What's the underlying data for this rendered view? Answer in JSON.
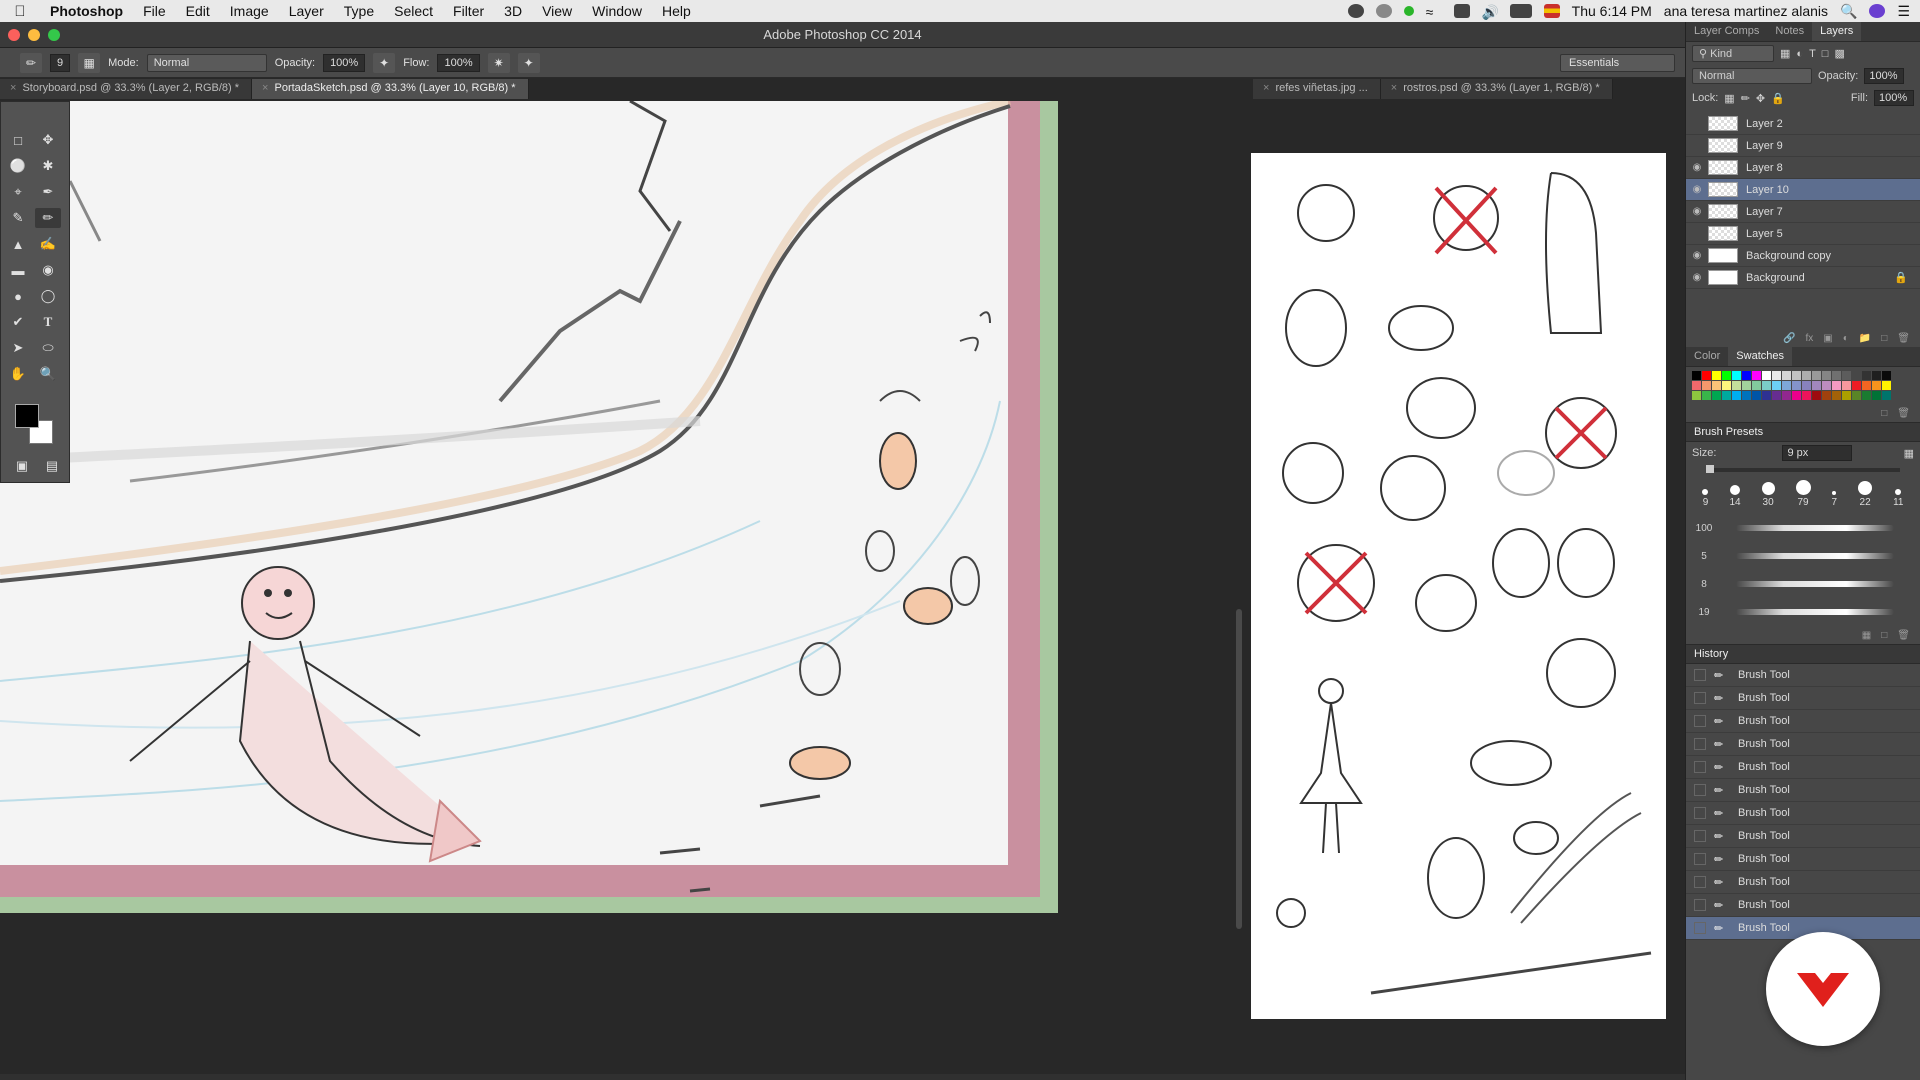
{
  "menubar": {
    "items": [
      "Photoshop",
      "File",
      "Edit",
      "Image",
      "Layer",
      "Type",
      "Select",
      "Filter",
      "3D",
      "View",
      "Window",
      "Help"
    ],
    "clock": "Thu 6:14 PM",
    "user": "ana teresa martinez alanis"
  },
  "window": {
    "title": "Adobe Photoshop CC 2014"
  },
  "options": {
    "brush_size": "9",
    "mode_label": "Mode:",
    "mode_value": "Normal",
    "opacity_label": "Opacity:",
    "opacity_value": "100%",
    "flow_label": "Flow:",
    "flow_value": "100%",
    "workspace": "Essentials"
  },
  "tabs": [
    {
      "label": "Storyboard.psd @ 33.3% (Layer 2, RGB/8) *"
    },
    {
      "label": "PortadaSketch.psd @ 33.3% (Layer 10, RGB/8) *"
    },
    {
      "label": "refes viñetas.jpg ..."
    },
    {
      "label": "rostros.psd @ 33.3% (Layer 1, RGB/8) *"
    }
  ],
  "panels": {
    "layers_tabs": [
      "Layer Comps",
      "Notes",
      "Layers"
    ],
    "kind_filter": "Kind",
    "blend_mode": "Normal",
    "opacity_label": "Opacity:",
    "opacity_value": "100%",
    "lock_label": "Lock:",
    "fill_label": "Fill:",
    "fill_value": "100%",
    "layers": [
      {
        "name": "Layer 2",
        "visible": false,
        "selected": false
      },
      {
        "name": "Layer 9",
        "visible": false,
        "selected": false
      },
      {
        "name": "Layer 8",
        "visible": true,
        "selected": false
      },
      {
        "name": "Layer 10",
        "visible": true,
        "selected": true
      },
      {
        "name": "Layer 7",
        "visible": true,
        "selected": false
      },
      {
        "name": "Layer 5",
        "visible": false,
        "selected": false
      },
      {
        "name": "Background copy",
        "visible": true,
        "selected": false
      },
      {
        "name": "Background",
        "visible": true,
        "selected": false
      }
    ],
    "color_tabs": [
      "Color",
      "Swatches"
    ],
    "brush_presets_title": "Brush Presets",
    "size_label": "Size:",
    "size_value": "9 px",
    "brush_tips": [
      "9",
      "14",
      "30",
      "79",
      "7",
      "22",
      "11"
    ],
    "stroke_sizes": [
      "100",
      "5",
      "8",
      "19"
    ],
    "history_title": "History",
    "history_items": [
      "Brush Tool",
      "Brush Tool",
      "Brush Tool",
      "Brush Tool",
      "Brush Tool",
      "Brush Tool",
      "Brush Tool",
      "Brush Tool",
      "Brush Tool",
      "Brush Tool",
      "Brush Tool",
      "Brush Tool"
    ]
  },
  "colors": {
    "canvas_border_pink": "#c9909f",
    "canvas_border_green": "#a8c8a0",
    "selection_blue": "#5d6e8f",
    "logo_red": "#e0201c"
  }
}
